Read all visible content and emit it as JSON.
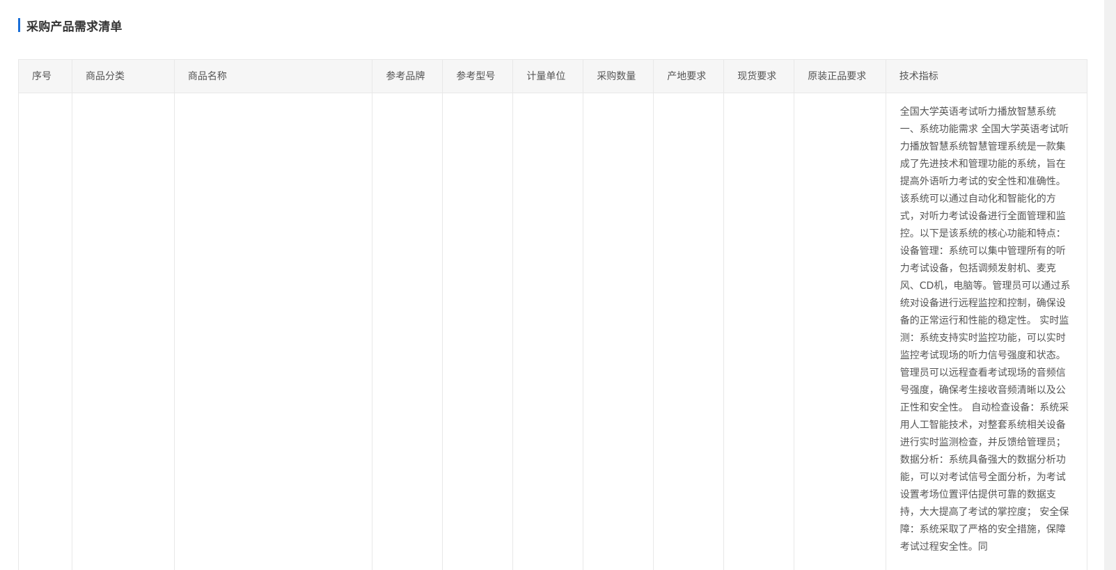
{
  "section": {
    "title": "采购产品需求清单"
  },
  "table": {
    "headers": [
      "序号",
      "商品分类",
      "商品名称",
      "参考品牌",
      "参考型号",
      "计量单位",
      "采购数量",
      "产地要求",
      "现货要求",
      "原装正品要求",
      "技术指标"
    ],
    "rows": [
      {
        "index": "",
        "category": "",
        "name": "",
        "brand": "",
        "model": "",
        "unit": "",
        "quantity": "",
        "origin": "",
        "stock": "",
        "genuine": "",
        "tech": "全国大学英语考试听力播放智慧系统 一、系统功能需求 全国大学英语考试听力播放智慧系统智慧管理系统是一款集成了先进技术和管理功能的系统，旨在提高外语听力考试的安全性和准确性。该系统可以通过自动化和智能化的方式，对听力考试设备进行全面管理和监控。以下是该系统的核心功能和特点： 设备管理：系统可以集中管理所有的听力考试设备，包括调频发射机、麦克风、CD机，电脑等。管理员可以通过系统对设备进行远程监控和控制，确保设备的正常运行和性能的稳定性。 实时监测：系统支持实时监控功能，可以实时监控考试现场的听力信号强度和状态。管理员可以远程查看考试现场的音频信号强度，确保考生接收音频清晰以及公正性和安全性。 自动检查设备：系统采用人工智能技术，对整套系统相关设备进行实时监测检查，并反馈给管理员； 数据分析：系统具备强大的数据分析功能，可以对考试信号全面分析，为考试设置考场位置评估提供可靠的数据支持，大大提高了考试的掌控度； 安全保障：系统采取了严格的安全措施，保障考试过程安全性。同"
      }
    ]
  }
}
